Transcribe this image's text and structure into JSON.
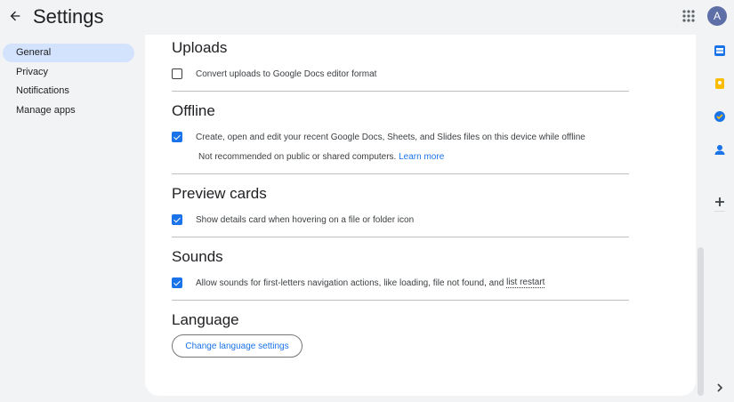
{
  "header": {
    "title": "Settings",
    "avatar_initial": "A"
  },
  "nav": {
    "items": [
      {
        "label": "General",
        "active": true
      },
      {
        "label": "Privacy"
      },
      {
        "label": "Notifications"
      },
      {
        "label": "Manage apps"
      }
    ]
  },
  "sections": {
    "uploads": {
      "title": "Uploads",
      "option": "Convert uploads to Google Docs editor format",
      "checked": false
    },
    "offline": {
      "title": "Offline",
      "option": "Create, open and edit your recent Google Docs, Sheets, and Slides files on this device while offline",
      "checked": true,
      "note": "Not recommended on public or shared computers.",
      "link": "Learn more"
    },
    "preview_cards": {
      "title": "Preview cards",
      "option": "Show details card when hovering on a file or folder icon",
      "checked": true
    },
    "sounds": {
      "title": "Sounds",
      "option_prefix": "Allow sounds for first-letters navigation actions, like loading, file not found, and",
      "option_link": "list restart",
      "checked": true
    },
    "language": {
      "title": "Language",
      "button": "Change language settings"
    }
  },
  "side_panel_icons": [
    "sheets-icon",
    "keep-icon",
    "tasks-icon",
    "contacts-icon",
    "add-icon"
  ],
  "colors": {
    "accent": "#1a73e8",
    "nav_active": "#d3e3fd",
    "background": "#f1f3f4"
  }
}
